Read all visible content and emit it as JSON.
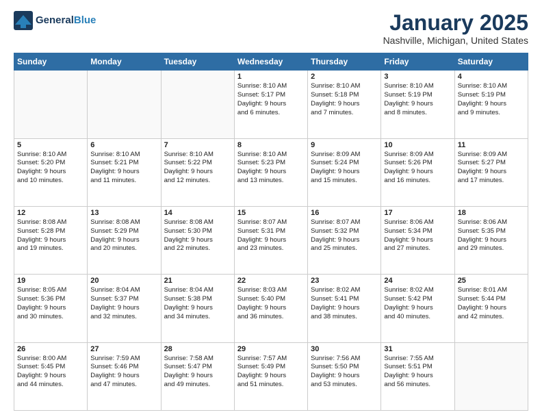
{
  "header": {
    "logo_line1": "General",
    "logo_line2": "Blue",
    "title": "January 2025",
    "location": "Nashville, Michigan, United States"
  },
  "weekdays": [
    "Sunday",
    "Monday",
    "Tuesday",
    "Wednesday",
    "Thursday",
    "Friday",
    "Saturday"
  ],
  "weeks": [
    [
      {
        "day": "",
        "text": ""
      },
      {
        "day": "",
        "text": ""
      },
      {
        "day": "",
        "text": ""
      },
      {
        "day": "1",
        "text": "Sunrise: 8:10 AM\nSunset: 5:17 PM\nDaylight: 9 hours\nand 6 minutes."
      },
      {
        "day": "2",
        "text": "Sunrise: 8:10 AM\nSunset: 5:18 PM\nDaylight: 9 hours\nand 7 minutes."
      },
      {
        "day": "3",
        "text": "Sunrise: 8:10 AM\nSunset: 5:19 PM\nDaylight: 9 hours\nand 8 minutes."
      },
      {
        "day": "4",
        "text": "Sunrise: 8:10 AM\nSunset: 5:19 PM\nDaylight: 9 hours\nand 9 minutes."
      }
    ],
    [
      {
        "day": "5",
        "text": "Sunrise: 8:10 AM\nSunset: 5:20 PM\nDaylight: 9 hours\nand 10 minutes."
      },
      {
        "day": "6",
        "text": "Sunrise: 8:10 AM\nSunset: 5:21 PM\nDaylight: 9 hours\nand 11 minutes."
      },
      {
        "day": "7",
        "text": "Sunrise: 8:10 AM\nSunset: 5:22 PM\nDaylight: 9 hours\nand 12 minutes."
      },
      {
        "day": "8",
        "text": "Sunrise: 8:10 AM\nSunset: 5:23 PM\nDaylight: 9 hours\nand 13 minutes."
      },
      {
        "day": "9",
        "text": "Sunrise: 8:09 AM\nSunset: 5:24 PM\nDaylight: 9 hours\nand 15 minutes."
      },
      {
        "day": "10",
        "text": "Sunrise: 8:09 AM\nSunset: 5:26 PM\nDaylight: 9 hours\nand 16 minutes."
      },
      {
        "day": "11",
        "text": "Sunrise: 8:09 AM\nSunset: 5:27 PM\nDaylight: 9 hours\nand 17 minutes."
      }
    ],
    [
      {
        "day": "12",
        "text": "Sunrise: 8:08 AM\nSunset: 5:28 PM\nDaylight: 9 hours\nand 19 minutes."
      },
      {
        "day": "13",
        "text": "Sunrise: 8:08 AM\nSunset: 5:29 PM\nDaylight: 9 hours\nand 20 minutes."
      },
      {
        "day": "14",
        "text": "Sunrise: 8:08 AM\nSunset: 5:30 PM\nDaylight: 9 hours\nand 22 minutes."
      },
      {
        "day": "15",
        "text": "Sunrise: 8:07 AM\nSunset: 5:31 PM\nDaylight: 9 hours\nand 23 minutes."
      },
      {
        "day": "16",
        "text": "Sunrise: 8:07 AM\nSunset: 5:32 PM\nDaylight: 9 hours\nand 25 minutes."
      },
      {
        "day": "17",
        "text": "Sunrise: 8:06 AM\nSunset: 5:34 PM\nDaylight: 9 hours\nand 27 minutes."
      },
      {
        "day": "18",
        "text": "Sunrise: 8:06 AM\nSunset: 5:35 PM\nDaylight: 9 hours\nand 29 minutes."
      }
    ],
    [
      {
        "day": "19",
        "text": "Sunrise: 8:05 AM\nSunset: 5:36 PM\nDaylight: 9 hours\nand 30 minutes."
      },
      {
        "day": "20",
        "text": "Sunrise: 8:04 AM\nSunset: 5:37 PM\nDaylight: 9 hours\nand 32 minutes."
      },
      {
        "day": "21",
        "text": "Sunrise: 8:04 AM\nSunset: 5:38 PM\nDaylight: 9 hours\nand 34 minutes."
      },
      {
        "day": "22",
        "text": "Sunrise: 8:03 AM\nSunset: 5:40 PM\nDaylight: 9 hours\nand 36 minutes."
      },
      {
        "day": "23",
        "text": "Sunrise: 8:02 AM\nSunset: 5:41 PM\nDaylight: 9 hours\nand 38 minutes."
      },
      {
        "day": "24",
        "text": "Sunrise: 8:02 AM\nSunset: 5:42 PM\nDaylight: 9 hours\nand 40 minutes."
      },
      {
        "day": "25",
        "text": "Sunrise: 8:01 AM\nSunset: 5:44 PM\nDaylight: 9 hours\nand 42 minutes."
      }
    ],
    [
      {
        "day": "26",
        "text": "Sunrise: 8:00 AM\nSunset: 5:45 PM\nDaylight: 9 hours\nand 44 minutes."
      },
      {
        "day": "27",
        "text": "Sunrise: 7:59 AM\nSunset: 5:46 PM\nDaylight: 9 hours\nand 47 minutes."
      },
      {
        "day": "28",
        "text": "Sunrise: 7:58 AM\nSunset: 5:47 PM\nDaylight: 9 hours\nand 49 minutes."
      },
      {
        "day": "29",
        "text": "Sunrise: 7:57 AM\nSunset: 5:49 PM\nDaylight: 9 hours\nand 51 minutes."
      },
      {
        "day": "30",
        "text": "Sunrise: 7:56 AM\nSunset: 5:50 PM\nDaylight: 9 hours\nand 53 minutes."
      },
      {
        "day": "31",
        "text": "Sunrise: 7:55 AM\nSunset: 5:51 PM\nDaylight: 9 hours\nand 56 minutes."
      },
      {
        "day": "",
        "text": ""
      }
    ]
  ]
}
